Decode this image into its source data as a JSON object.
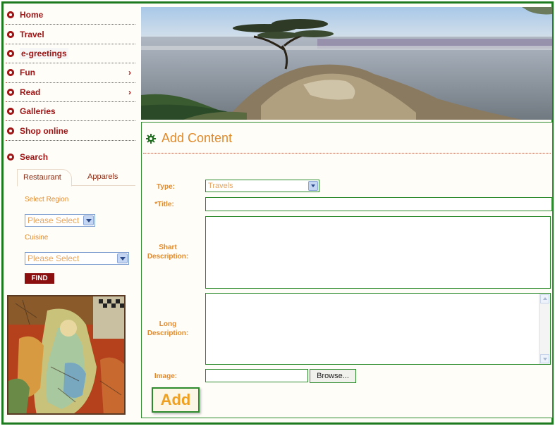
{
  "nav": {
    "items": [
      {
        "label": "Home",
        "arrow": ""
      },
      {
        "label": "Travel",
        "arrow": ""
      },
      {
        "label": "e-greetings",
        "arrow": ""
      },
      {
        "label": "Fun",
        "arrow": "›"
      },
      {
        "label": "Read",
        "arrow": "›"
      },
      {
        "label": "Galleries",
        "arrow": ""
      },
      {
        "label": "Shop online",
        "arrow": ""
      }
    ]
  },
  "search": {
    "heading": "Search",
    "tabs": [
      "Restaurant",
      "Apparels"
    ],
    "region_label": "Select Region",
    "region_value": "Please Select",
    "cuisine_label": "Cuisine",
    "cuisine_value": "Please Select",
    "find_label": "FIND"
  },
  "content": {
    "title": "Add Content",
    "type_label": "Type:",
    "type_value": "Travels",
    "title_label": "*Title:",
    "short_desc_label_1": "Shart",
    "short_desc_label_2": "Description:",
    "long_desc_label_1": "Long",
    "long_desc_label_2": "Description:",
    "image_label": "Image:",
    "browse_label": "Browse...",
    "add_label": "Add"
  },
  "colors": {
    "accent_red": "#a01515",
    "label_orange": "#e08a2c",
    "border_green": "#2d8a2d",
    "find_button": "#8b0f0f"
  },
  "icons": {
    "nav_bullet": "circle-bullet-icon",
    "title_icon": "gear-icon"
  }
}
